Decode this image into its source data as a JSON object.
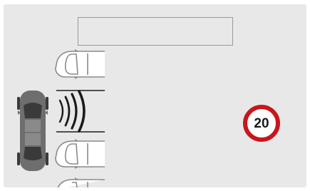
{
  "message_box": {
    "text": ""
  },
  "speed_limit": {
    "value": "20",
    "ring_color": "#c8161d"
  },
  "icons": {
    "own_vehicle": "car-top-view-icon",
    "parked_vehicle": "parked-car-icon",
    "sensor_waves": "ultrasonic-waves-icon",
    "speed_sign": "speed-limit-sign-icon"
  },
  "colors": {
    "background": "#e8e8e8",
    "own_car": "#6e6e6e",
    "parked_car_outline": "#8a8a8a",
    "waves": "#1a1a1a"
  }
}
